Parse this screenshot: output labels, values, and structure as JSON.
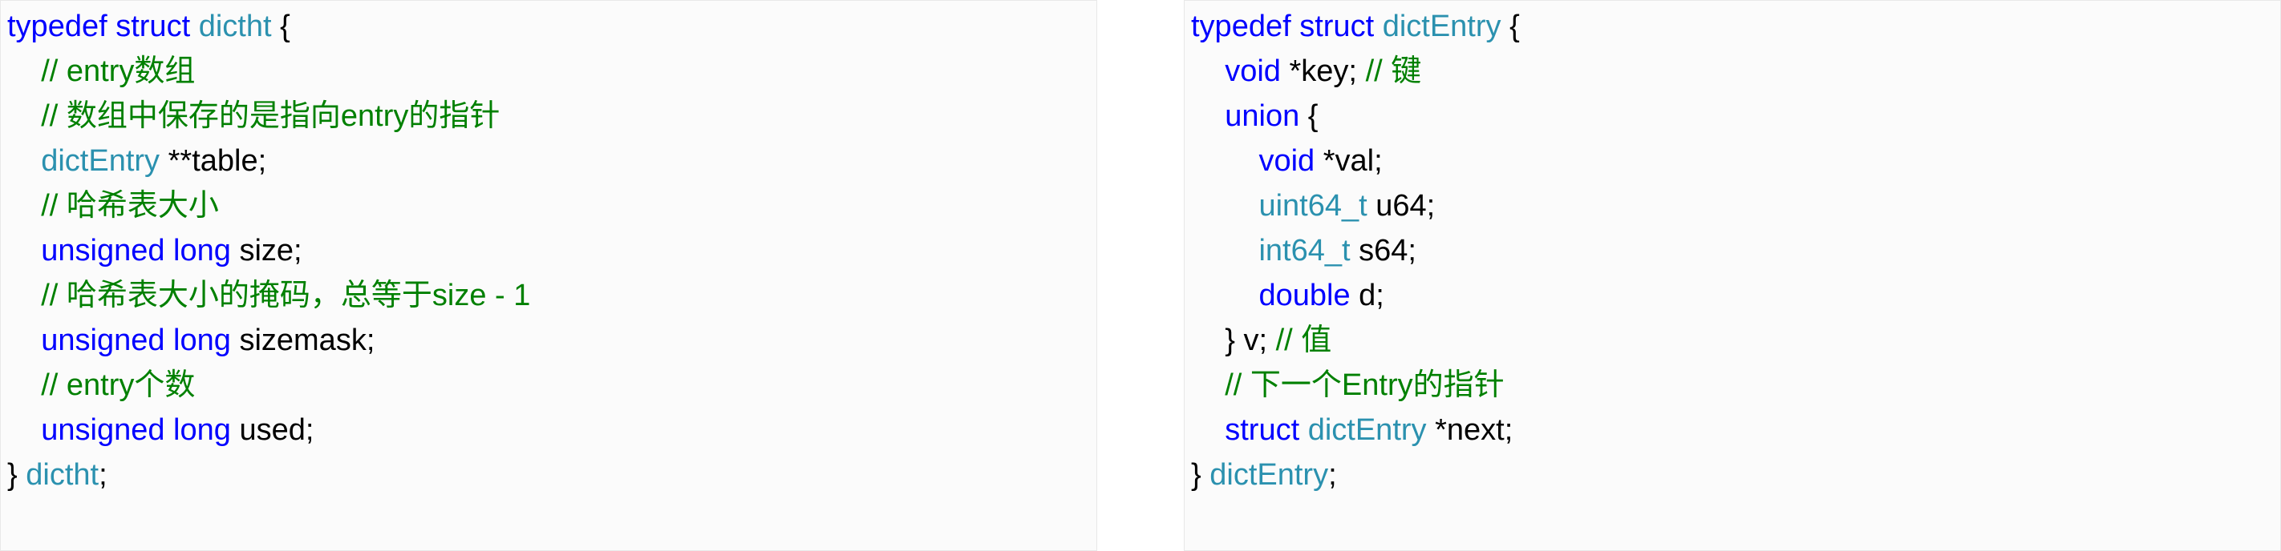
{
  "left": {
    "l1_typedef": "typedef",
    "l1_struct": "struct",
    "l1_name": "dictht",
    "l1_brace": " {",
    "l2_comment": "    // entry数组",
    "l3_comment": "    // 数组中保存的是指向entry的指针",
    "l4_indent": "    ",
    "l4_type": "dictEntry",
    "l4_rest": " **table;",
    "l5_comment": "    // 哈希表大小",
    "l6_indent": "    ",
    "l6_unsigned": "unsigned",
    "l6_sp": " ",
    "l6_long": "long",
    "l6_rest": " size;",
    "l7_comment": "    // 哈希表大小的掩码，总等于size - 1",
    "l8_indent": "    ",
    "l8_unsigned": "unsigned",
    "l8_sp": " ",
    "l8_long": "long",
    "l8_rest": " sizemask;",
    "l9_comment": "    // entry个数",
    "l10_indent": "    ",
    "l10_unsigned": "unsigned",
    "l10_sp": " ",
    "l10_long": "long",
    "l10_rest": " used;",
    "l11_brace": "} ",
    "l11_name": "dictht",
    "l11_semi": ";"
  },
  "right": {
    "r1_typedef": "typedef",
    "r1_struct": "struct",
    "r1_name": "dictEntry",
    "r1_brace": " {",
    "r2_indent": "    ",
    "r2_void": "void",
    "r2_rest": " *key; ",
    "r2_comment": "// 键",
    "r3_indent": "    ",
    "r3_union": "union",
    "r3_brace": " {",
    "r4_indent": "        ",
    "r4_void": "void",
    "r4_rest": " *val;",
    "r5_indent": "        ",
    "r5_type": "uint64_t",
    "r5_rest": " u64;",
    "r6_indent": "        ",
    "r6_type": "int64_t",
    "r6_rest": " s64;",
    "r7_indent": "        ",
    "r7_double": "double",
    "r7_rest": " d;",
    "r8_indent": "    ",
    "r8_close": "} v; ",
    "r8_comment": "// 值",
    "r9_comment": "    // 下一个Entry的指针",
    "r10_indent": "    ",
    "r10_struct": "struct",
    "r10_sp": " ",
    "r10_type": "dictEntry",
    "r10_rest": " *next;",
    "r11_brace": "} ",
    "r11_name": "dictEntry",
    "r11_semi": ";"
  }
}
